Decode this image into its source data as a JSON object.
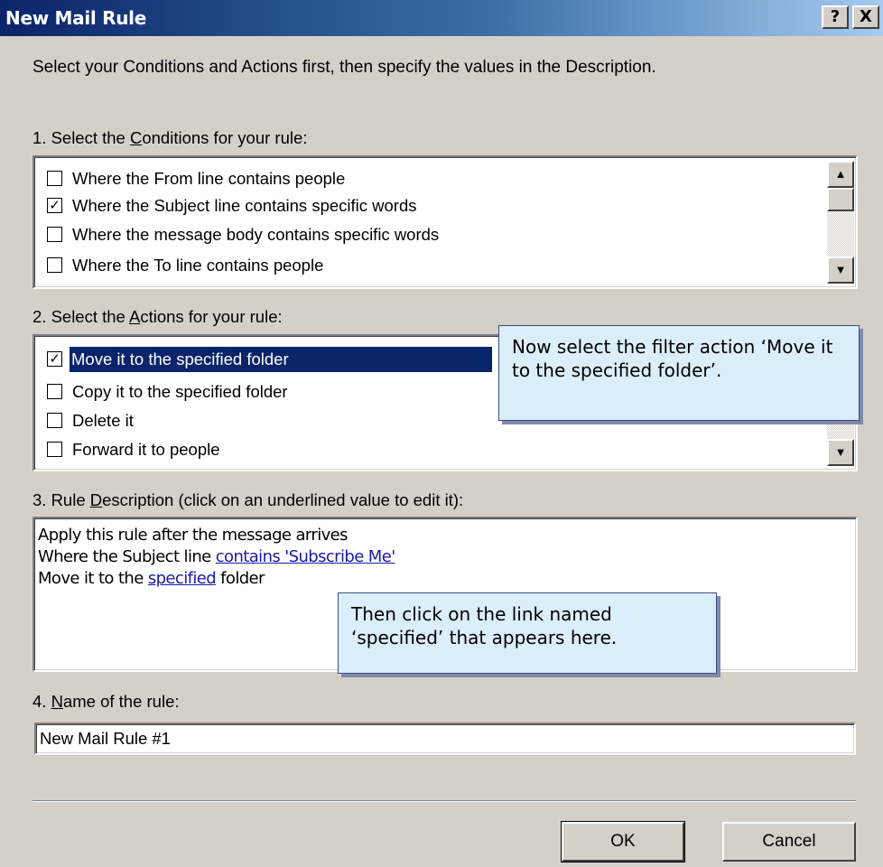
{
  "window": {
    "title": "New Mail Rule",
    "help_label": "?",
    "close_label": "X"
  },
  "intro": "Select your Conditions and Actions first, then specify the values in the Description.",
  "conditions": {
    "label_pre": "1. Select the ",
    "label_key": "C",
    "label_post": "onditions for your rule:",
    "items": [
      {
        "label": "Where the From line contains people",
        "checked": ""
      },
      {
        "label": "Where the Subject line contains specific words",
        "checked": "✓"
      },
      {
        "label": "Where the message body contains specific words",
        "checked": ""
      },
      {
        "label": "Where the To line contains people",
        "checked": ""
      }
    ]
  },
  "actions": {
    "label_pre": "2. Select the ",
    "label_key": "A",
    "label_post": "ctions for your rule:",
    "items": [
      {
        "label": "Move it to the specified folder",
        "checked": "✓",
        "selected": true
      },
      {
        "label": "Copy it to the specified folder",
        "checked": ""
      },
      {
        "label": "Delete it",
        "checked": ""
      },
      {
        "label": "Forward it to people",
        "checked": ""
      }
    ]
  },
  "description": {
    "label_pre": "3. Rule ",
    "label_key": "D",
    "label_post": "escription (click on an underlined value to edit it):",
    "line1": "Apply this rule after the message arrives",
    "line2_pre": "Where the Subject line ",
    "line2_link": "contains 'Subscribe Me'",
    "line3_pre": "Move it to the ",
    "line3_link": "specified",
    "line3_post": " folder"
  },
  "name": {
    "label_pre": "4. ",
    "label_key": "N",
    "label_post": "ame of the rule:",
    "value": "New Mail Rule #1"
  },
  "buttons": {
    "ok": "OK",
    "cancel": "Cancel"
  },
  "callouts": {
    "action_tip": "Now select the filter action ‘Move it to the specified folder’.",
    "link_tip": "Then click on the link named ‘specified’ that appears here."
  },
  "icons": {
    "scroll_up": "▲",
    "scroll_down": "▼"
  }
}
